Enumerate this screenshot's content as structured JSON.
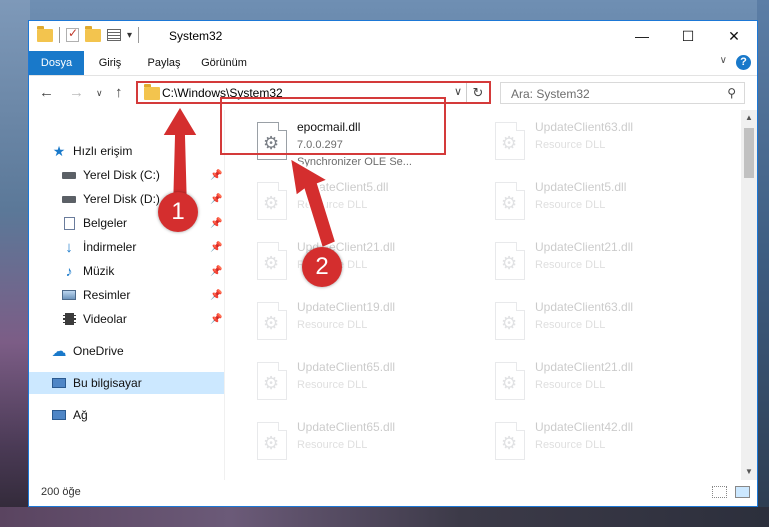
{
  "window": {
    "title": "System32"
  },
  "ribbon": {
    "tabs": [
      "Dosya",
      "Giriş",
      "Paylaş",
      "Görünüm"
    ],
    "active_tab": "Dosya"
  },
  "address": {
    "path": "C:\\Windows\\System32",
    "search_placeholder": "Ara: System32"
  },
  "nav": {
    "quick_access": "Hızlı erişim",
    "items": [
      "Yerel Disk (C:)",
      "Yerel Disk (D:)",
      "Belgeler",
      "İndirmeler",
      "Müzik",
      "Resimler",
      "Videolar"
    ],
    "onedrive": "OneDrive",
    "this_pc": "Bu bilgisayar",
    "network": "Ağ"
  },
  "files": {
    "highlight": {
      "name": "epocmail.dll",
      "version": "7.0.0.297",
      "description": "Synchronizer OLE Se..."
    },
    "left_col": [
      {
        "name": "UpdateClient5.dll",
        "desc": "Resource DLL"
      },
      {
        "name": "UpdateClient21.dll",
        "desc": "Resource DLL"
      },
      {
        "name": "UpdateClient19.dll",
        "desc": "Resource DLL"
      },
      {
        "name": "UpdateClient65.dll",
        "desc": "Resource DLL"
      },
      {
        "name": "UpdateClient65.dll",
        "desc": "Resource DLL"
      }
    ],
    "right_col": [
      {
        "name": "UpdateClient63.dll",
        "desc": "Resource DLL"
      },
      {
        "name": "UpdateClient5.dll",
        "desc": "Resource DLL"
      },
      {
        "name": "UpdateClient21.dll",
        "desc": "Resource DLL"
      },
      {
        "name": "UpdateClient63.dll",
        "desc": "Resource DLL"
      },
      {
        "name": "UpdateClient21.dll",
        "desc": "Resource DLL"
      },
      {
        "name": "UpdateClient42.dll",
        "desc": "Resource DLL"
      }
    ]
  },
  "status": {
    "count": "200 öğe"
  },
  "annotations": {
    "step1": "1",
    "step2": "2"
  },
  "colors": {
    "accent": "#1979ca",
    "annotation_red": "#d42e2e"
  }
}
